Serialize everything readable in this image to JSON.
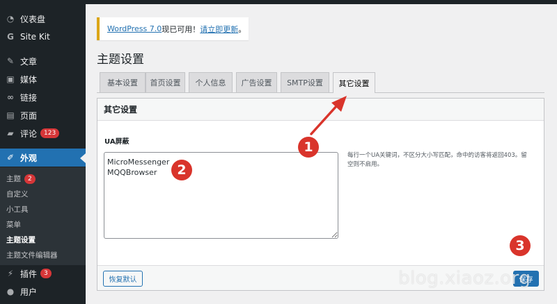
{
  "sidebar": {
    "items": [
      {
        "label": "仪表盘",
        "icon": "dashboard-icon"
      },
      {
        "label": "Site Kit",
        "icon": "site-kit-icon"
      },
      {
        "label": "文章",
        "icon": "pin-icon"
      },
      {
        "label": "媒体",
        "icon": "media-icon"
      },
      {
        "label": "链接",
        "icon": "link-icon"
      },
      {
        "label": "页面",
        "icon": "page-icon"
      },
      {
        "label": "评论",
        "icon": "comment-icon",
        "badge": "123"
      },
      {
        "label": "外观",
        "icon": "brush-icon",
        "current": true
      },
      {
        "label": "插件",
        "icon": "plugin-icon",
        "badge": "3"
      },
      {
        "label": "用户",
        "icon": "user-icon"
      }
    ],
    "submenu": [
      {
        "label": "主题",
        "badge": "2"
      },
      {
        "label": "自定义"
      },
      {
        "label": "小工具"
      },
      {
        "label": "菜单"
      },
      {
        "label": "主题设置",
        "current": true
      },
      {
        "label": "主题文件编辑器"
      }
    ]
  },
  "notice": {
    "version_link": "WordPress 7.0",
    "text": "现已可用！",
    "update_link": "请立即更新",
    "suffix": "。"
  },
  "page": {
    "title": "主题设置"
  },
  "tabs": [
    {
      "label": "基本设置"
    },
    {
      "label": "首页设置"
    },
    {
      "label": "个人信息"
    },
    {
      "label": "广告设置"
    },
    {
      "label": "SMTP设置"
    },
    {
      "label": "其它设置",
      "active": true
    }
  ],
  "panel": {
    "heading": "其它设置",
    "field_label": "UA屏蔽",
    "textarea_value": "MicroMessenger\nMQQBrowser",
    "description": "每行一个UA关键词，不区分大小写匹配，命中的访客将返回403。留空则不启用。",
    "reset_label": "恢复默认",
    "save_label": "保存"
  },
  "annotations": {
    "marker_1": "1",
    "marker_2": "2",
    "marker_3": "3",
    "color": "#d9342b"
  },
  "watermark": "blog.xiaoz.org",
  "colors": {
    "admin_dark": "#1d2327",
    "accent": "#2271b1",
    "badge": "#d63638",
    "notice_border": "#dba617"
  }
}
